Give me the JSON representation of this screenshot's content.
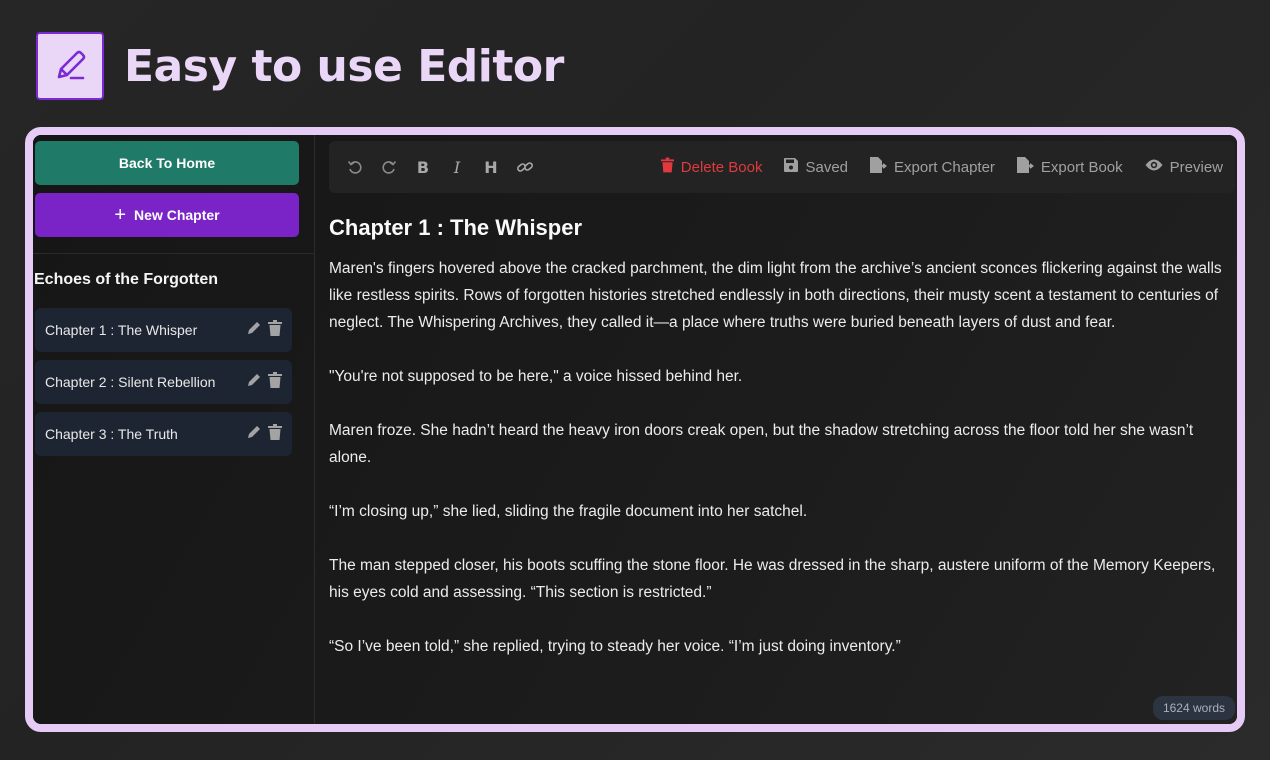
{
  "hero": {
    "title": "Easy to use Editor"
  },
  "sidebar": {
    "back_home": "Back To Home",
    "new_chapter": "New Chapter",
    "book_title": "Echoes of the Forgotten",
    "chapters": [
      {
        "label": "Chapter 1 : The Whisper"
      },
      {
        "label": "Chapter 2 : Silent Rebellion"
      },
      {
        "label": "Chapter 3 : The Truth"
      }
    ]
  },
  "toolbar": {
    "undo_icon": "undo-icon",
    "redo_icon": "redo-icon",
    "bold": "B",
    "italic": "I",
    "heading": "H",
    "link_icon": "link-icon",
    "delete_book": "Delete Book",
    "saved": "Saved",
    "export_chapter": "Export Chapter",
    "export_book": "Export Book",
    "preview": "Preview"
  },
  "editor": {
    "chapter_title": "Chapter 1 : The Whisper",
    "paragraphs": [
      "Maren's fingers hovered above the cracked parchment, the dim light from the archive’s ancient sconces flickering against the walls like restless spirits. Rows of forgotten histories stretched endlessly in both directions, their musty scent a testament to centuries of neglect. The Whispering Archives, they called it—a place where truths were buried beneath layers of dust and fear.",
      "\"You're not supposed to be here,\" a voice hissed behind her.",
      "Maren froze. She hadn’t heard the heavy iron doors creak open, but the shadow stretching across the floor told her she wasn’t alone.",
      "“I’m closing up,” she lied, sliding the fragile document into her satchel.",
      "The man stepped closer, his boots scuffing the stone floor. He was dressed in the sharp, austere uniform of the Memory Keepers, his eyes cold and assessing. “This section is restricted.”",
      "“So I’ve been told,” she replied, trying to steady her voice. “I’m just doing inventory.”"
    ],
    "word_count": "1624 words"
  },
  "colors": {
    "accent_purple": "#7a24c8",
    "home_green": "#1f7a68",
    "danger_red": "#e0393e",
    "frame_lilac": "#e6cbf6"
  }
}
